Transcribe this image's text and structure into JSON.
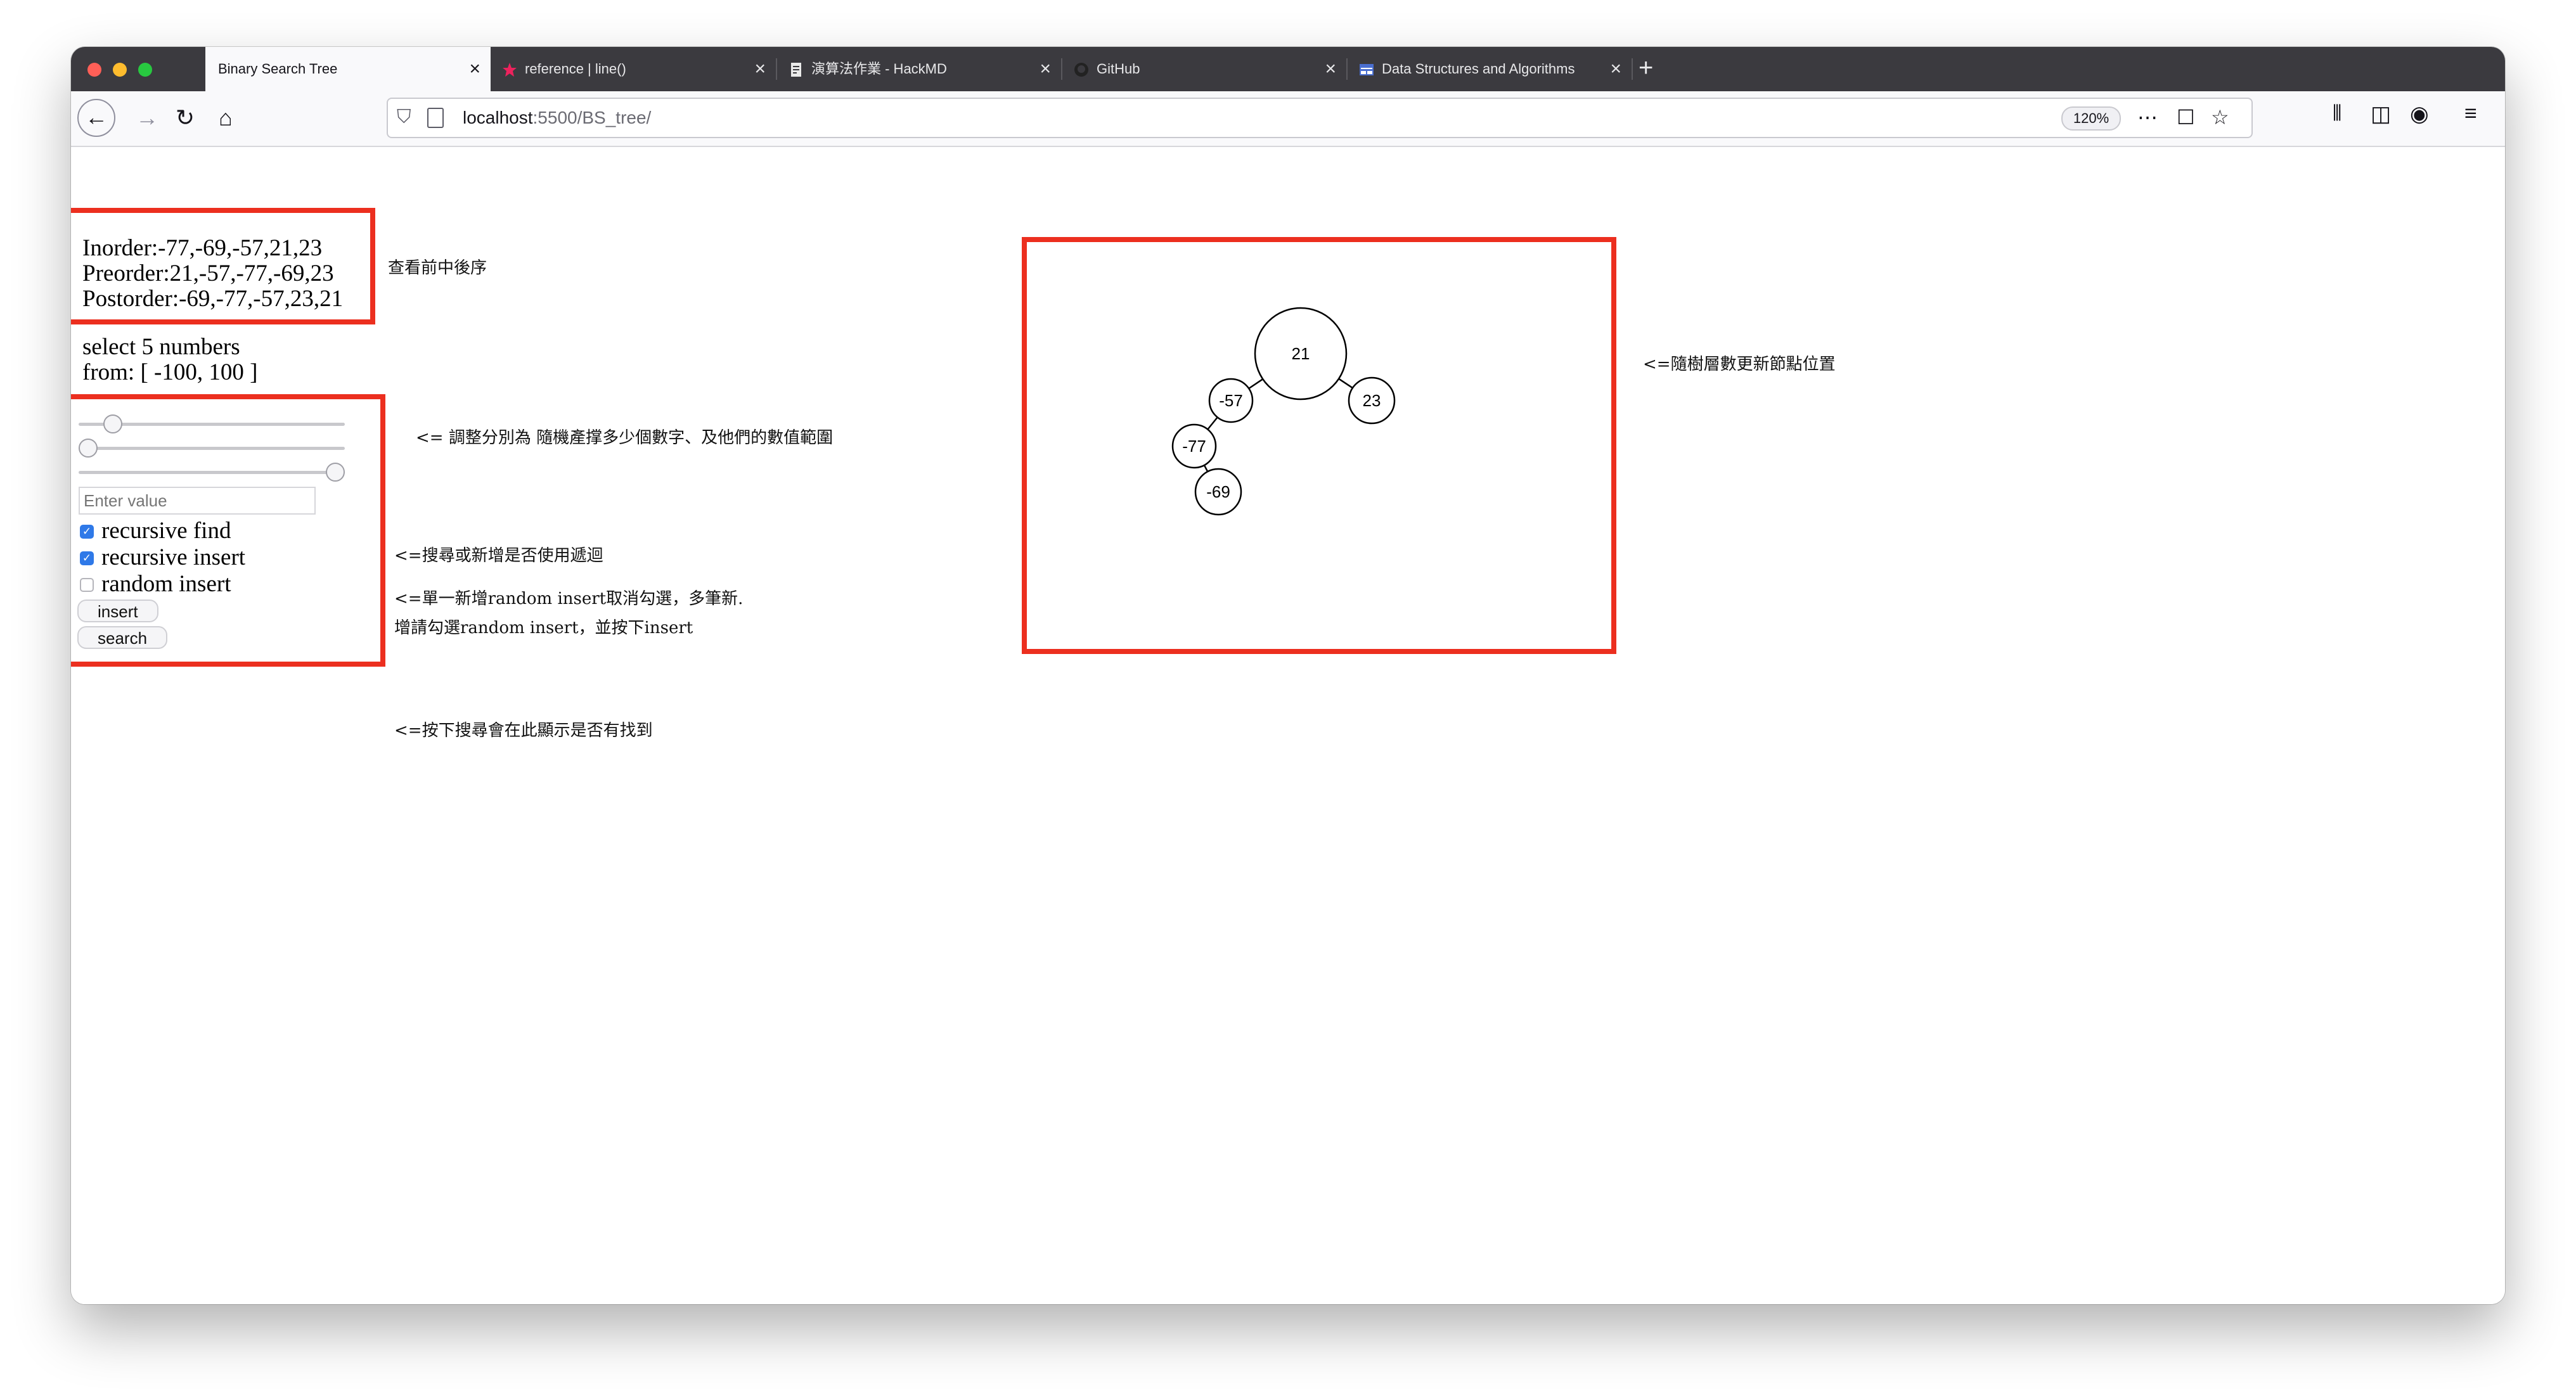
{
  "browser": {
    "tabs": [
      {
        "title": "Binary Search Tree",
        "active": true
      },
      {
        "title": "reference | line()"
      },
      {
        "title": "演算法作業 - HackMD"
      },
      {
        "title": "GitHub"
      },
      {
        "title": "Data Structures and Algorithms"
      }
    ],
    "url_host": "localhost",
    "url_path": ":5500/BS_tree/",
    "zoom": "120%"
  },
  "traversal": {
    "inorder": "Inorder:-77,-69,-57,21,23",
    "preorder": "Preorder:21,-57,-77,-69,23",
    "postorder": "Postorder:-69,-77,-57,23,21"
  },
  "selection": {
    "line1": "select 5 numbers",
    "line2": "from: [ -100, 100 ]"
  },
  "controls": {
    "sliders": [
      {
        "name": "count",
        "value": 5,
        "min": 0,
        "max": 50
      },
      {
        "name": "range-min",
        "value": -100,
        "min": -100,
        "max": 0
      },
      {
        "name": "range-max",
        "value": 100,
        "min": 0,
        "max": 100
      }
    ],
    "value_placeholder": "Enter value",
    "recursive_find": "recursive find",
    "recursive_insert": "recursive insert",
    "random_insert": "random insert",
    "insert_label": "insert",
    "search_label": "search"
  },
  "notes": {
    "traversal_note": "查看前中後序",
    "slider_note": "<= 調整分別為 隨機產撑多少個數字、及他們的數值範圍",
    "recursion_note": "<=搜尋或新增是否使用遞迴",
    "random_note_1": "<=單一新增random insert取消勾選，多筆新.",
    "random_note_2": "增請勾選random insert，並按下insert",
    "search_note": "<=按下搜尋會在此顯示是否有找到",
    "tree_note": "<=隨樹層數更新節點位置"
  },
  "tree": {
    "nodes": [
      {
        "key": "21",
        "label": "21"
      },
      {
        "key": "-57",
        "label": "-57"
      },
      {
        "key": "23",
        "label": "23"
      },
      {
        "key": "-77",
        "label": "-77"
      },
      {
        "key": "-69",
        "label": "-69"
      }
    ],
    "edges": [
      [
        "21",
        "-57"
      ],
      [
        "21",
        "23"
      ],
      [
        "-57",
        "-77"
      ],
      [
        "-77",
        "-69"
      ]
    ]
  }
}
